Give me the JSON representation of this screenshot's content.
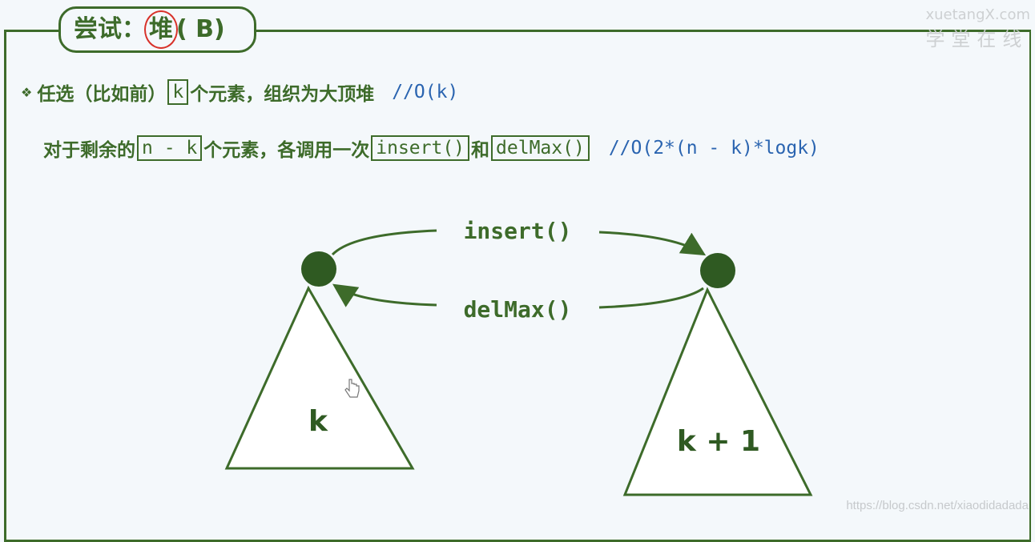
{
  "slide": {
    "title_prefix": "尝试：",
    "title_highlight": "堆",
    "title_suffix": "( B)",
    "bullet": "❖",
    "line1": {
      "a": "任选（比如前）",
      "code": "k",
      "b": "个元素，组织为大顶堆",
      "comment": "//O(k)"
    },
    "line2": {
      "a": "对于剩余的",
      "code1": "n - k",
      "b": "个元素，各调用一次",
      "code2": "insert()",
      "c": "和",
      "code3": "delMax()",
      "comment": "//O(2*(n - k)*logk)"
    }
  },
  "diagram": {
    "insert_label": "insert()",
    "delmax_label": "delMax()",
    "left_tree_label": "k",
    "right_tree_label": "k + 1"
  },
  "watermark": {
    "brand": "xuetangX.com",
    "brand_cn": "学堂在线",
    "url": "https://blog.csdn.net/xiaodidadada"
  },
  "colors": {
    "green": "#3d6b2a",
    "blue": "#2a64b0",
    "red": "#d8322a"
  }
}
